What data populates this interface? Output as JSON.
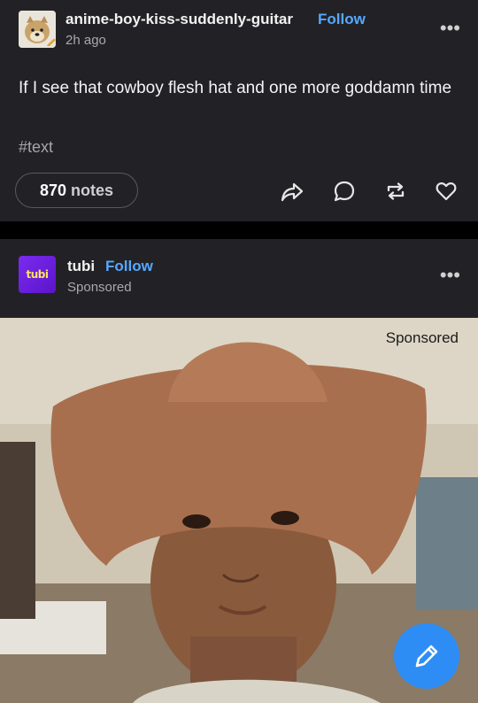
{
  "post1": {
    "blog_name": "anime-boy-kiss-suddenly-guitar",
    "follow_label": "Follow",
    "time_ago": "2h ago",
    "body": "If I see that cowboy flesh hat and one more goddamn time",
    "tag": "#text",
    "notes_count": "870",
    "notes_label": "notes"
  },
  "post2": {
    "blog_name": "tubi",
    "follow_label": "Follow",
    "sponsored": "Sponsored",
    "avatar_text": "tubi",
    "image_sponsored": "Sponsored"
  },
  "colors": {
    "post_bg": "#222226",
    "accent_follow": "#56a8ff",
    "fab": "#2e8df5",
    "tubi_purple": "#7a2cf0"
  }
}
